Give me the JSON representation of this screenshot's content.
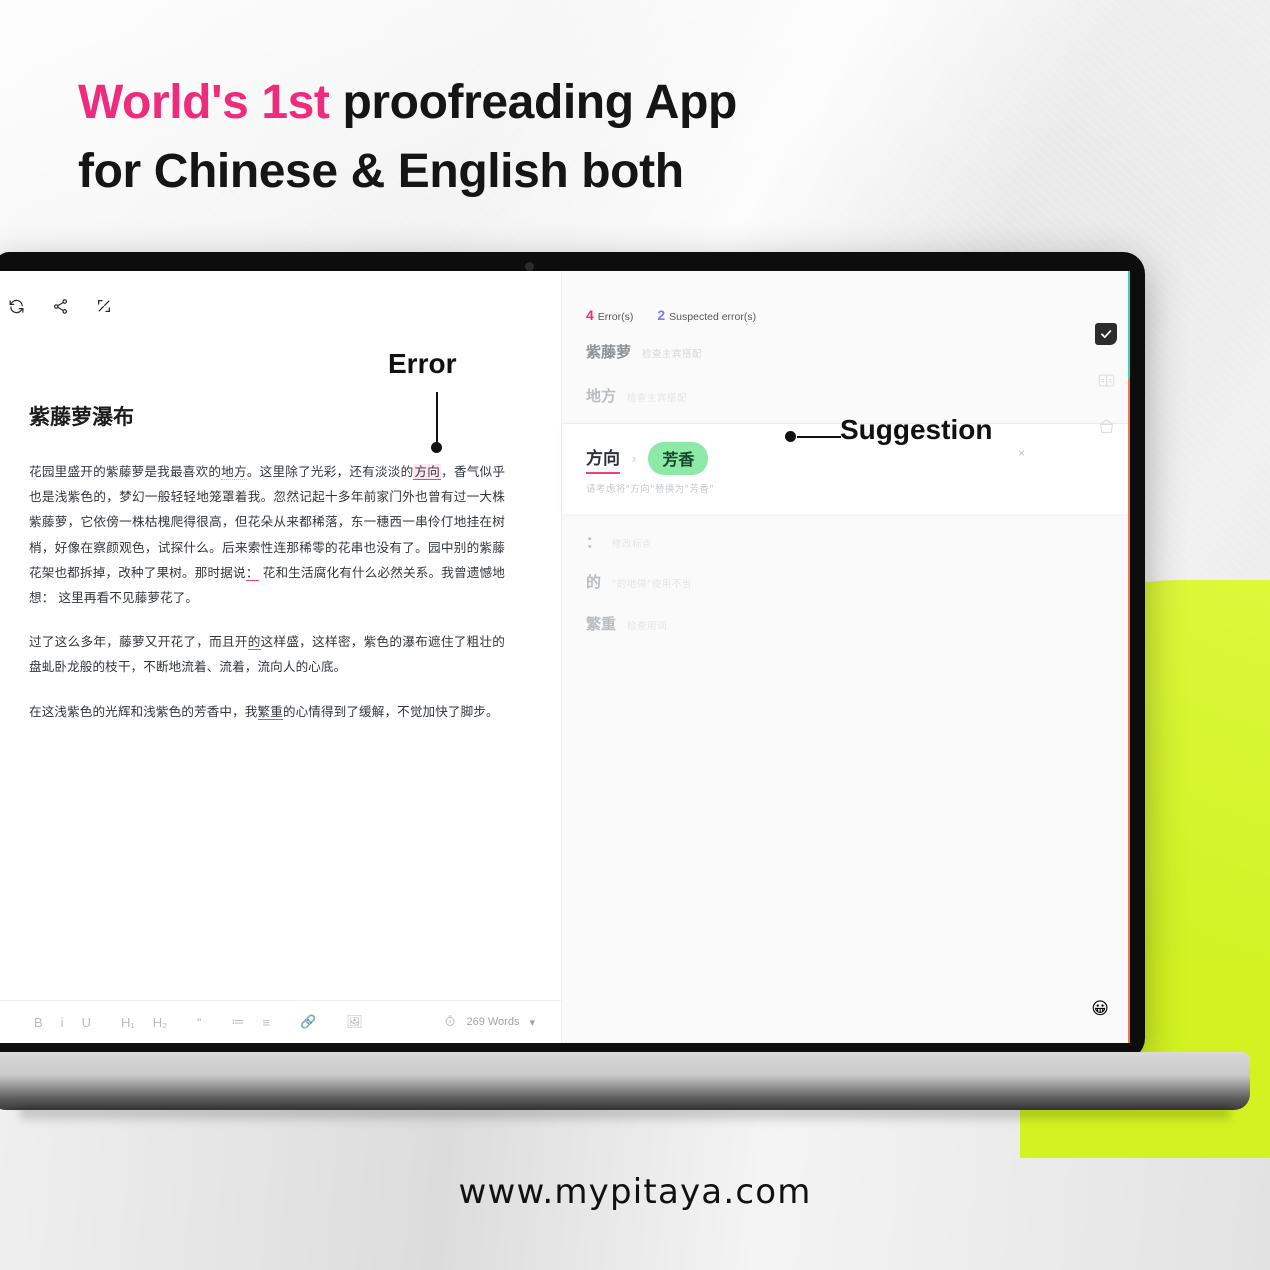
{
  "headline": {
    "line1_highlight": "World's 1st",
    "line1_rest": " proofreading App",
    "line2": "for Chinese & English both",
    "highlight_color": "#ee2c7b"
  },
  "footer": {
    "url": "www.mypitaya.com"
  },
  "callouts": {
    "error": "Error",
    "suggestion": "Suggestion"
  },
  "editor": {
    "top_tools": [
      {
        "name": "sync-icon",
        "label": "Sync"
      },
      {
        "name": "share-icon",
        "label": "Share"
      },
      {
        "name": "fullscreen-icon",
        "label": "Fullscreen"
      }
    ],
    "doc_title": "紫藤萝瀑布",
    "paragraphs": [
      {
        "segments": [
          {
            "t": "花园里盛开的紫藤萝是我最喜欢的",
            "s": "plain"
          },
          {
            "t": "地方",
            "s": "dotted"
          },
          {
            "t": "。这里除了光彩，还有淡淡的",
            "s": "plain"
          },
          {
            "t": "方向",
            "s": "error"
          },
          {
            "t": "，香气似乎也是浅紫色的，梦幻一般轻轻地笼罩着我。忽然记起十多年前家门外也曾有过一大株紫藤萝，它依傍一株枯槐爬得很高，但花朵从来都稀落，东一穗西一串伶仃地挂在树梢，好像在察颜观色，试探什么。后来索性连那稀零的花串也没有了。园中别的紫藤花架也都拆掉，改种了果树。那时据说",
            "s": "plain"
          },
          {
            "t": "：",
            "s": "underline"
          },
          {
            "t": " 花和生活腐化有什么必然关系。我曾遗憾地想： 这里再看不见藤萝花了。",
            "s": "plain"
          }
        ]
      },
      {
        "segments": [
          {
            "t": "过了这么多年，藤萝又开花了，而且开",
            "s": "plain"
          },
          {
            "t": "的",
            "s": "underline"
          },
          {
            "t": "这样盛，这样密，紫色的瀑布遮住了粗壮的盘虬卧龙般的枝干，不断地流着、流着，流向人的心底。",
            "s": "plain"
          }
        ]
      },
      {
        "segments": [
          {
            "t": "在这浅紫色的光辉和浅紫色的芳香中，我",
            "s": "plain"
          },
          {
            "t": "繁重",
            "s": "underline"
          },
          {
            "t": "的心情得到了缓解，不觉加快了脚步。",
            "s": "plain"
          }
        ]
      }
    ],
    "format_tools": [
      {
        "name": "bold-button",
        "label": "B"
      },
      {
        "name": "italic-button",
        "label": "i"
      },
      {
        "name": "underline-button",
        "label": "U"
      },
      {
        "name": "heading1-button",
        "label": "H₁"
      },
      {
        "name": "heading2-button",
        "label": "H₂"
      },
      {
        "name": "quote-button",
        "label": "“"
      },
      {
        "name": "ordered-list-button",
        "label": "≔"
      },
      {
        "name": "unordered-list-button",
        "label": "≡"
      },
      {
        "name": "link-button",
        "label": "🔗"
      },
      {
        "name": "image-button",
        "label": "🖼"
      }
    ],
    "status": {
      "timer_icon": "timer-icon",
      "word_count": "269 Words",
      "dropdown_caret": "▾"
    }
  },
  "panel": {
    "counts": {
      "error_number": "4",
      "error_label": "Error(s)",
      "error_color": "#ee2c7b",
      "suspected_number": "2",
      "suspected_label": "Suspected error(s)",
      "suspected_color": "#7b7bf0"
    },
    "issues_top": [
      {
        "word": "紫藤萝",
        "desc": "检查主宾搭配"
      },
      {
        "word": "地方",
        "desc": "检查主宾搭配"
      }
    ],
    "active_card": {
      "original": "方向",
      "arrow": "›",
      "suggestion": "芳香",
      "suggestion_bg": "#8ee8a8",
      "hint": "请考虑将\"方向\"替换为\"芳香\"",
      "close": "×"
    },
    "issues_bottom": [
      {
        "word": "：",
        "desc": "修改标点"
      },
      {
        "word": "的",
        "desc": "\"的地得\"使用不当"
      },
      {
        "word": "繁重",
        "desc": "检查用词"
      }
    ],
    "rail": [
      {
        "name": "check-badge-icon",
        "active": true
      },
      {
        "name": "compare-split-icon",
        "active": false
      },
      {
        "name": "trash-basket-icon",
        "active": false
      }
    ],
    "emoji": "😀"
  }
}
